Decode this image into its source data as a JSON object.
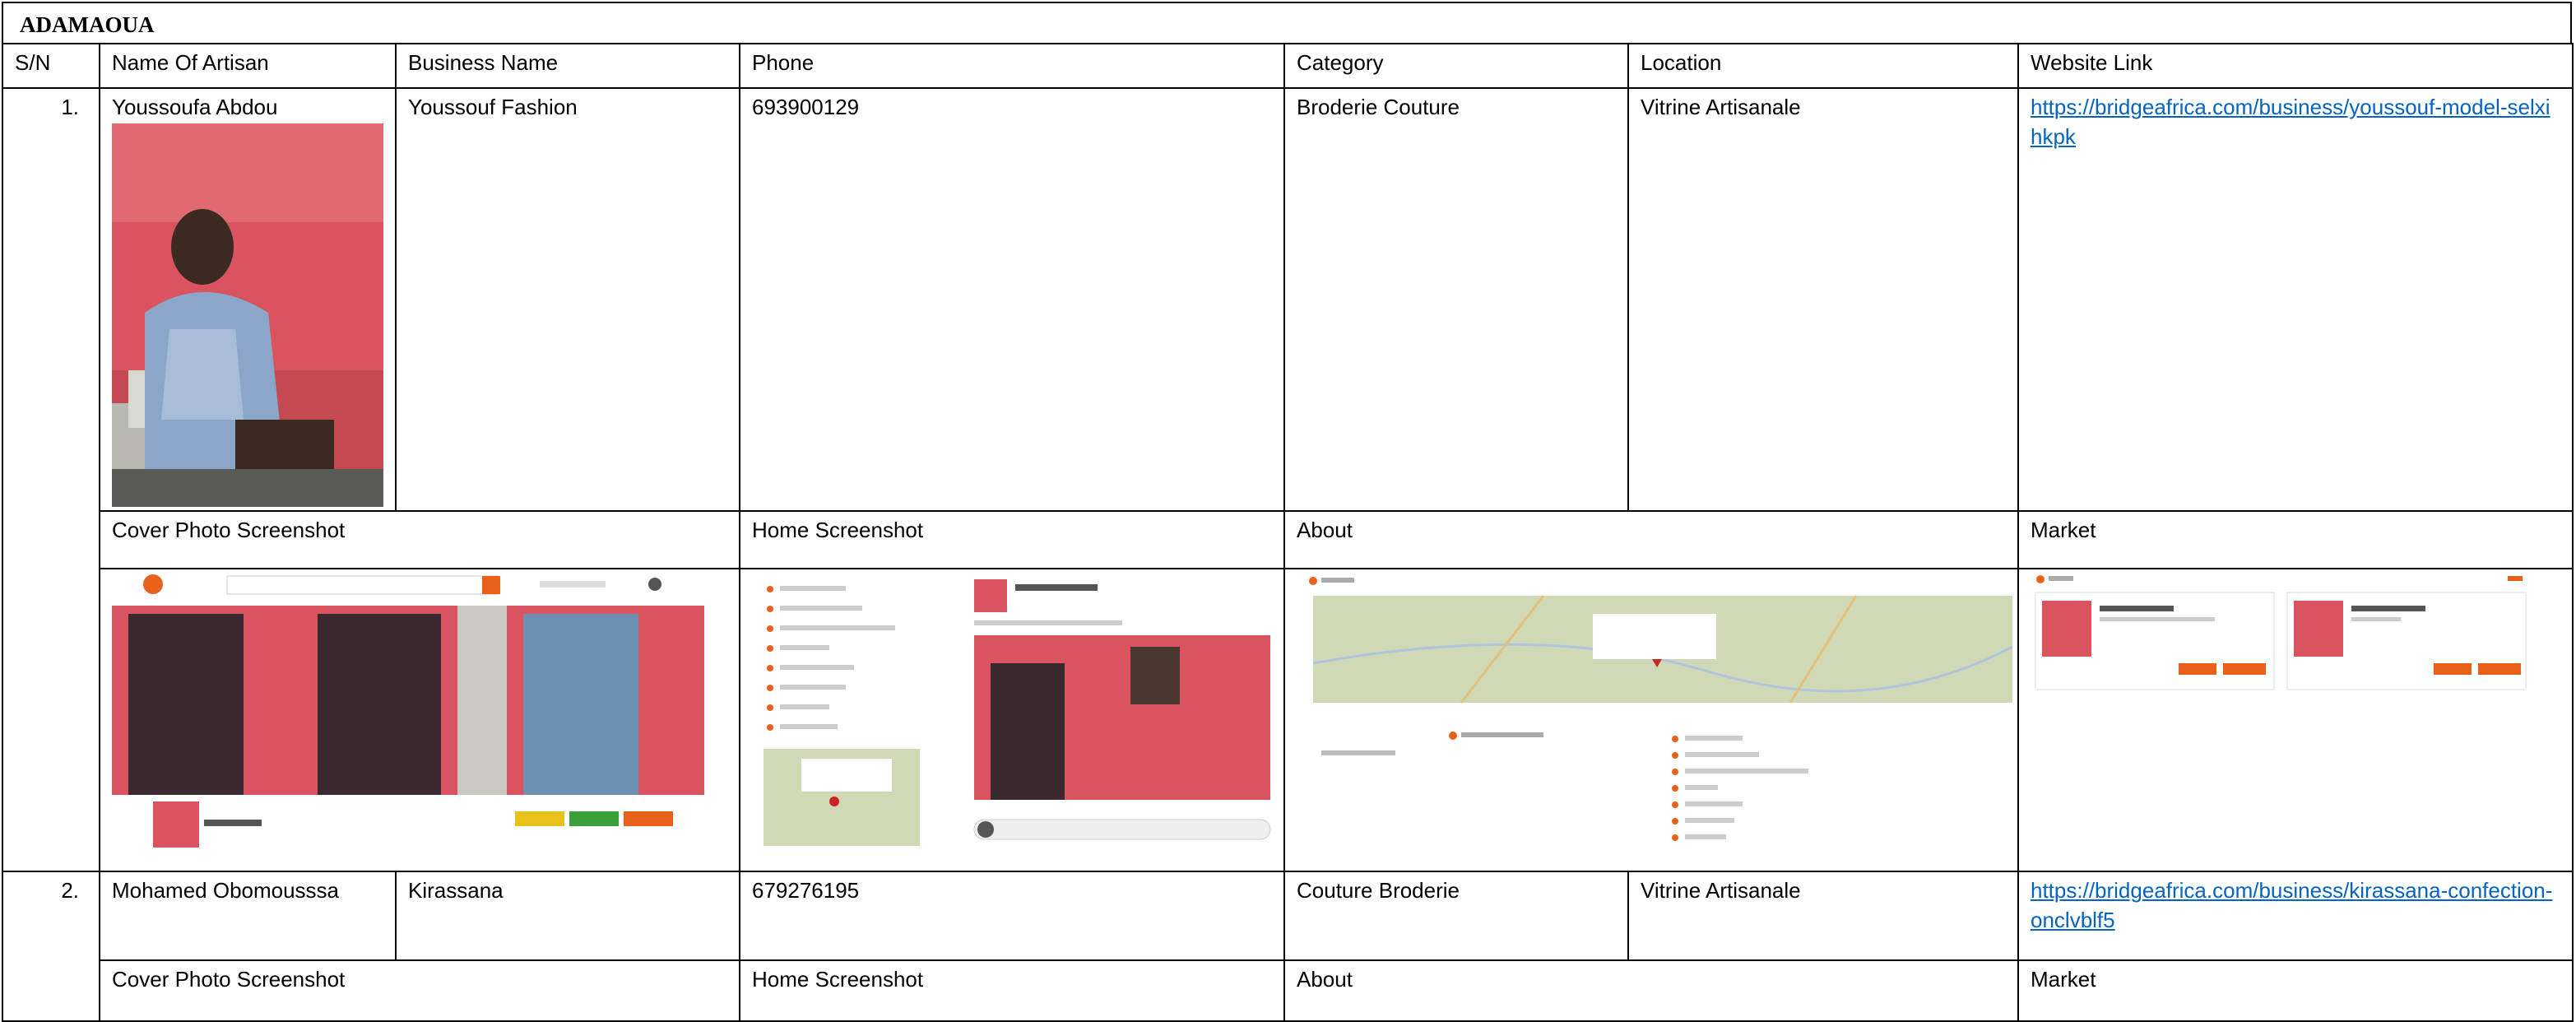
{
  "region": "ADAMAOUA",
  "columns": [
    "S/N",
    "Name Of Artisan",
    "Business Name",
    "Phone",
    "Category",
    "Location",
    "Website Link"
  ],
  "shot_labels": {
    "cover": "Cover Photo Screenshot",
    "home": "Home Screenshot",
    "about": "About",
    "market": "Market"
  },
  "artisans": [
    {
      "sn": "1.",
      "name": "Youssoufa Abdou",
      "business": "Youssouf Fashion",
      "phone": "693900129",
      "category": "Broderie Couture",
      "location": "Vitrine Artisanale",
      "website": "https://bridgeafrica.com/business/youssouf-model-selxihkpk"
    },
    {
      "sn": "2.",
      "name": "Mohamed Obomousssa",
      "business": "Kirassana",
      "phone": "679276195",
      "category": "Couture Broderie",
      "location": "Vitrine Artisanale",
      "website": "https://bridgeafrica.com/business/kirassana-confection-onclvblf5"
    }
  ],
  "colors": {
    "link": "#0563c1",
    "brand_orange": "#e8611a",
    "photo_wall": "#d9545e",
    "map_green": "#cfd9b5"
  }
}
